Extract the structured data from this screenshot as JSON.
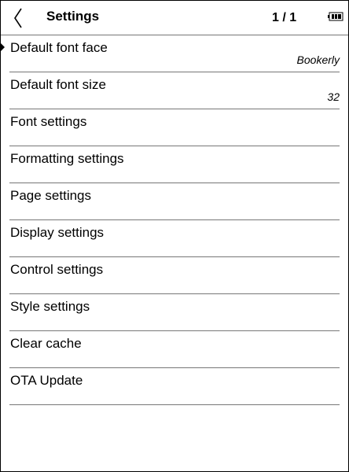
{
  "header": {
    "title": "Settings",
    "page_indicator": "1 / 1"
  },
  "icons": {
    "back": "chevron-left-icon",
    "battery": "battery-icon",
    "selection": "selection-cursor-icon"
  },
  "settings": {
    "items": [
      {
        "label": "Default font face",
        "value": "Bookerly"
      },
      {
        "label": "Default font size",
        "value": "32"
      },
      {
        "label": "Font settings"
      },
      {
        "label": "Formatting settings"
      },
      {
        "label": "Page settings"
      },
      {
        "label": "Display settings"
      },
      {
        "label": "Control settings"
      },
      {
        "label": "Style settings"
      },
      {
        "label": "Clear cache"
      },
      {
        "label": "OTA Update"
      }
    ]
  }
}
